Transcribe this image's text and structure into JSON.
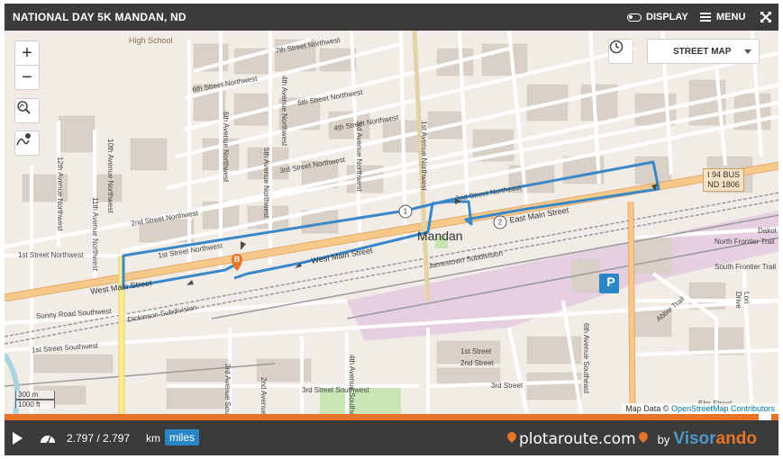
{
  "header": {
    "title": "NATIONAL DAY 5K MANDAN, ND",
    "display_label": "DISPLAY",
    "menu_label": "MENU"
  },
  "map": {
    "zoom_in": "+",
    "zoom_out": "−",
    "layer_select": "STREET MAP",
    "attribution_prefix": "Map Data © ",
    "attribution_link": "OpenStreetMap Contributors",
    "scale_m": "300 m",
    "scale_ft": "1000 ft",
    "labels": {
      "city": "Mandan",
      "high_school": "High School",
      "west_main_1": "West Main Street",
      "west_main_2": "West Main Street",
      "east_main": "East Main Street",
      "street_2nd_nw": "2nd Street Northwest",
      "street_1st_nw": "1st Street Northwest",
      "street_1st_nw_b": "1st Street Northwest",
      "street_3rd_nw": "3rd Street Northwest",
      "street_4th_nw": "4th Street Northwest",
      "street_5th_nw": "5th Street Northwest",
      "street_6th_nw": "6th Street Northwest",
      "street_7th_nw": "7th Street Northwest",
      "street_1st_sw": "1st Street Southwest",
      "street_3rd_sw": "3rd Street Southwest",
      "street_2nd": "2nd Street",
      "street_1st": "1st Street",
      "street_3rd": "3rd Street",
      "sunny_road": "Sunny Road Southwest",
      "ave_6th_se": "6th Avenue Southeast",
      "ave_1st_nw": "1st Avenue Northwest",
      "ave_3rd_nw": "3rd Avenue Northwest",
      "ave_4th_nw": "4th Avenue Northwest",
      "ave_5th_nw": "5th Avenue Northwest",
      "ave_6th_nw": "6th Avenue Northwest",
      "ave_10th_nw": "10th Avenue Northwest",
      "ave_11th_nw": "11th Avenue Northwest",
      "ave_12th_nw": "12th Avenue Northwest",
      "ave_3rd_sw": "3rd Avenue Southwest",
      "ave_4th_sw": "4th Avenue Southwest",
      "ave_2nd_sw": "2nd Avenue Southwest",
      "north_frontier": "North Frontier Trail",
      "south_frontier": "South Frontier Trail",
      "abbie_trail": "Abbie Trail",
      "jamestown": "Jamestown Subdivision",
      "dickinson": "Dickinson Subdivision",
      "parking": "P",
      "route_shield": "I 94 BUS\nND 1806",
      "marker_b": "B",
      "km_1": "1",
      "km_2": "2",
      "southeast_2nd": "2nd Street Northeast",
      "dakota": "Dakot",
      "lori": "Lori Drive",
      "elm": "Elm Street"
    }
  },
  "player": {
    "distance": "2.797 / 2.797",
    "unit_km": "km",
    "unit_miles": "miles",
    "progress_fraction": 1.0,
    "brand_name": "plotaroute.com",
    "by": "by",
    "partner_1": "Visor",
    "partner_2": "ando"
  },
  "colors": {
    "route": "#3a88c9",
    "accent": "#e8742a",
    "bar": "#3b3b3b",
    "major_road": "#f6c98a",
    "railway_area": "#e6cfe0"
  }
}
